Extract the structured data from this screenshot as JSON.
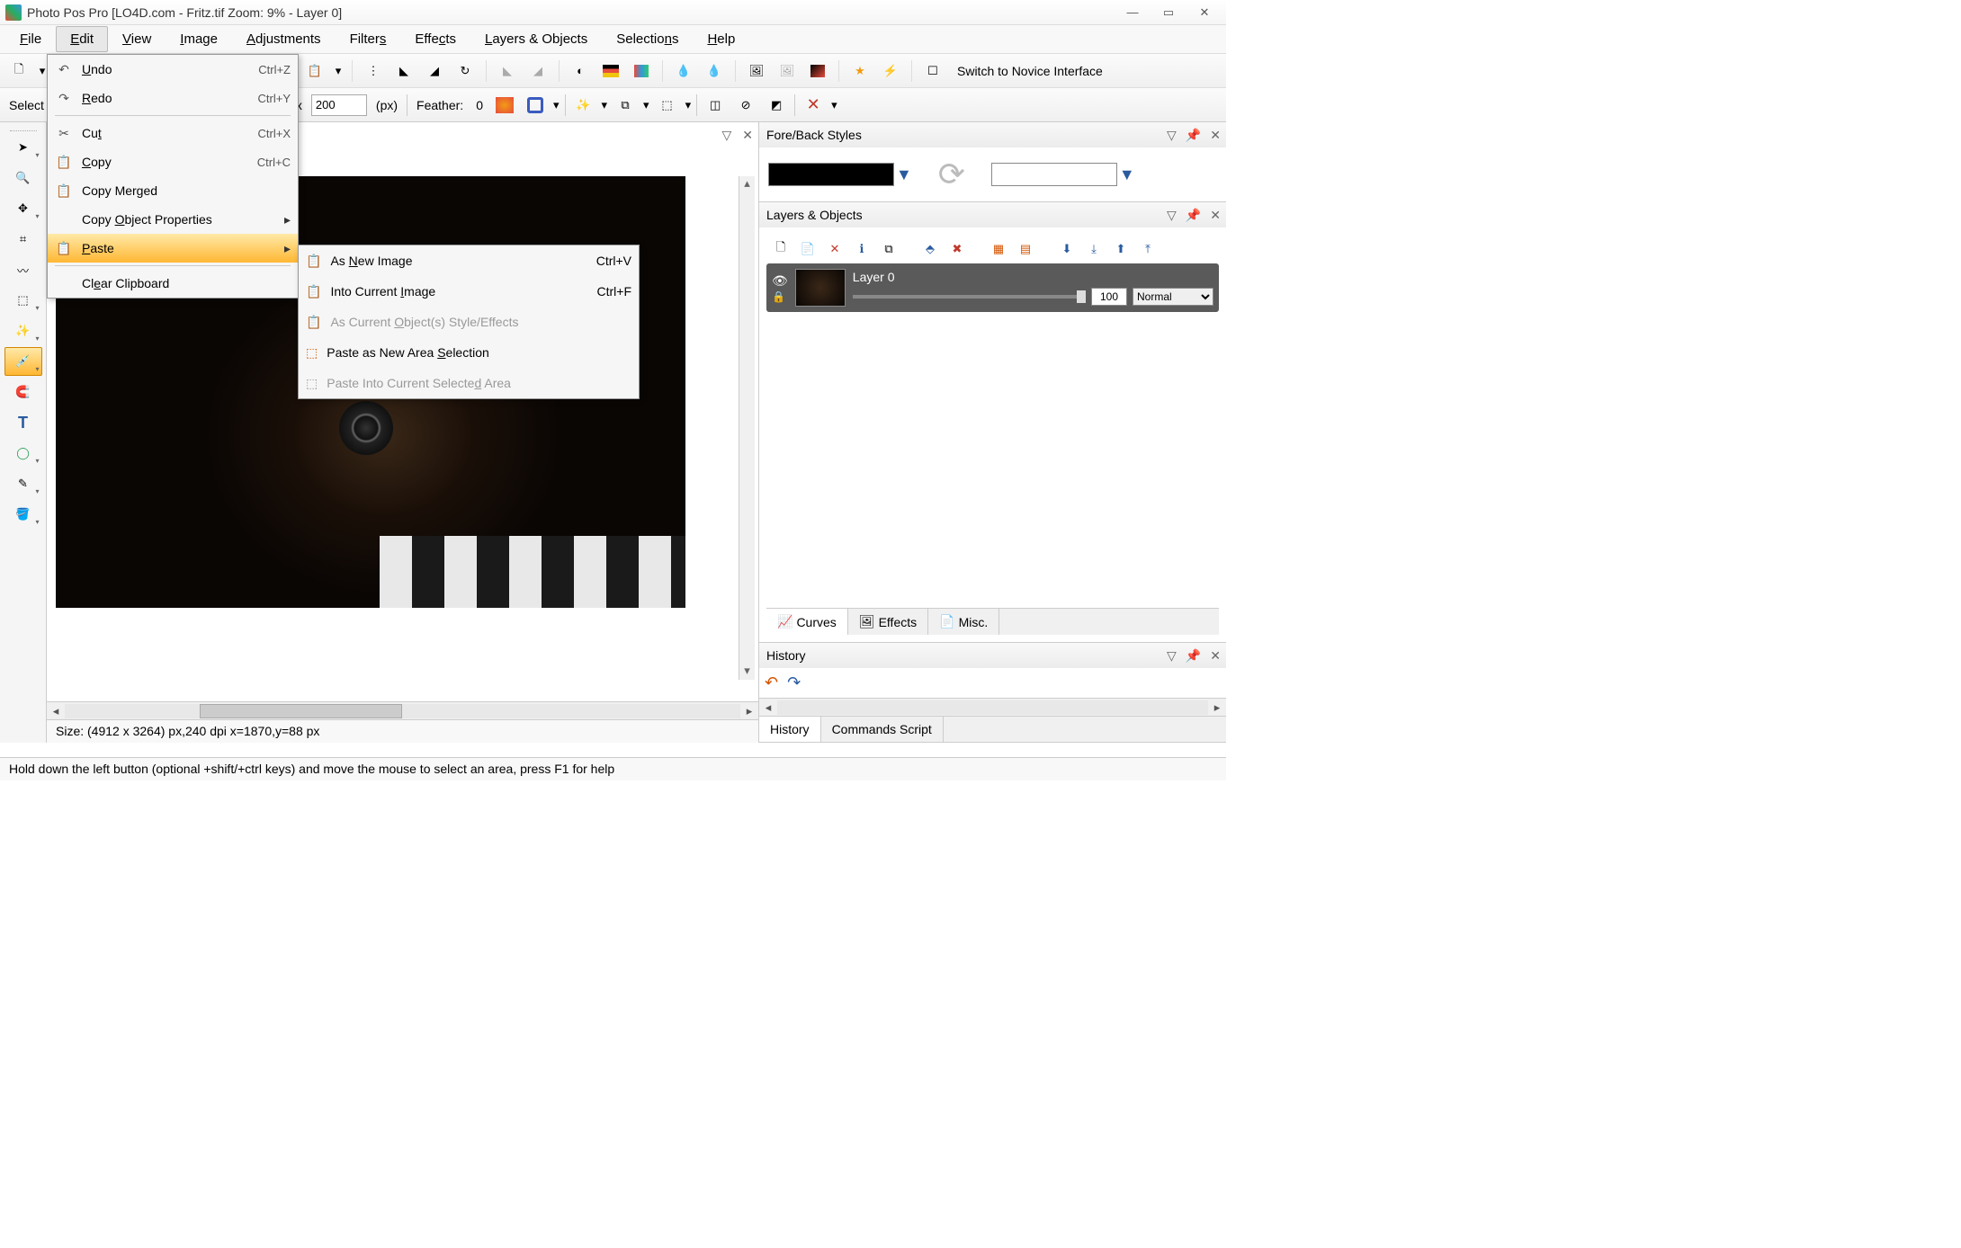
{
  "title": "Photo Pos Pro [LO4D.com - Fritz.tif Zoom: 9% - Layer 0]",
  "menubar": {
    "file": "File",
    "edit": "Edit",
    "view": "View",
    "image": "Image",
    "adjustments": "Adjustments",
    "filters": "Filters",
    "effects": "Effects",
    "layers": "Layers & Objects",
    "selections": "Selections",
    "help": "Help"
  },
  "toolbar_switch": "Switch to Novice Interface",
  "options": {
    "select_label": "Select",
    "x_label": "x",
    "size_value": "200",
    "unit": "(px)",
    "feather_label": "Feather:",
    "feather_value": "0"
  },
  "edit_menu": {
    "undo": {
      "label": "Undo",
      "shortcut": "Ctrl+Z"
    },
    "redo": {
      "label": "Redo",
      "shortcut": "Ctrl+Y"
    },
    "cut": {
      "label": "Cut",
      "shortcut": "Ctrl+X"
    },
    "copy": {
      "label": "Copy",
      "shortcut": "Ctrl+C"
    },
    "copy_merged": {
      "label": "Copy Merged"
    },
    "copy_obj_props": {
      "label": "Copy Object Properties"
    },
    "paste": {
      "label": "Paste"
    },
    "clear_clipboard": {
      "label": "Clear Clipboard"
    }
  },
  "paste_submenu": {
    "as_new": {
      "label": "As New Image",
      "shortcut": "Ctrl+V"
    },
    "into_current": {
      "label": "Into Current Image",
      "shortcut": "Ctrl+F"
    },
    "as_current_obj": {
      "label": "As Current Object(s) Style/Effects"
    },
    "paste_area": {
      "label": "Paste as New Area Selection"
    },
    "paste_into_sel": {
      "label": "Paste Into Current Selected Area"
    }
  },
  "panels": {
    "fore_back": "Fore/Back Styles",
    "layers": "Layers & Objects",
    "history": "History"
  },
  "layers": {
    "name": "Layer 0",
    "opacity": "100",
    "blend": "Normal"
  },
  "layer_tabs": {
    "curves": "Curves",
    "effects": "Effects",
    "misc": "Misc."
  },
  "history_tabs": {
    "history": "History",
    "commands": "Commands Script"
  },
  "doc_status": "Size: (4912 x 3264) px,240 dpi    x=1870,y=88 px",
  "statusbar": "Hold down the left button (optional +shift/+ctrl keys) and move the mouse to select an area, press F1 for help"
}
